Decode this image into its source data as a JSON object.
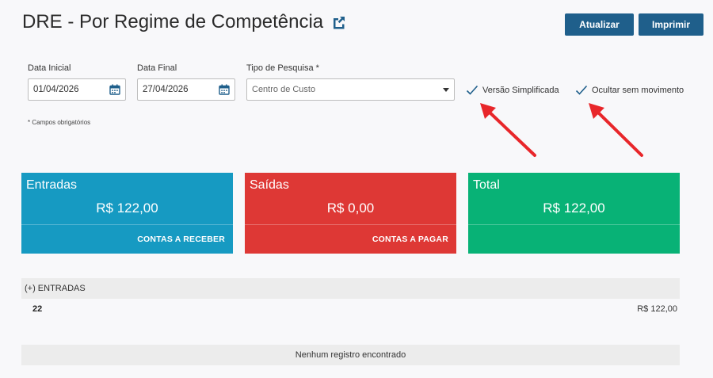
{
  "header": {
    "title": "DRE - Por Regime de Competência",
    "refresh_label": "Atualizar",
    "print_label": "Imprimir"
  },
  "filters": {
    "start_date": {
      "label": "Data Inicial",
      "value": "01/04/2026"
    },
    "end_date": {
      "label": "Data Final",
      "value": "27/04/2026"
    },
    "search_type": {
      "label": "Tipo de Pesquisa *",
      "value": "Centro de Custo"
    },
    "simplified": {
      "label": "Versão Simplificada",
      "checked": true
    },
    "hide_no_movement": {
      "label": "Ocultar sem movimento",
      "checked": true
    },
    "required_note": "* Campos obrigatórios"
  },
  "cards": {
    "entradas": {
      "title": "Entradas",
      "value": "R$ 122,00",
      "link": "CONTAS A RECEBER",
      "color": "#169ac2"
    },
    "saidas": {
      "title": "Saídas",
      "value": "R$ 0,00",
      "link": "CONTAS A PAGAR",
      "color": "#de3835"
    },
    "total": {
      "title": "Total",
      "value": "R$ 122,00",
      "color": "#08b276"
    }
  },
  "report": {
    "section_title": "(+) ENTRADAS",
    "rows": [
      {
        "label": "22",
        "value": "R$ 122,00"
      }
    ],
    "empty_message": "Nenhum registro encontrado"
  },
  "colors": {
    "primary_button": "#1f5f8b",
    "check": "#1f5f8b",
    "annotation_arrow": "#e8262a"
  },
  "icons": {
    "title": "external-link-icon",
    "date": "calendar-icon",
    "select": "chevron-down-icon",
    "check": "checkmark-icon"
  }
}
